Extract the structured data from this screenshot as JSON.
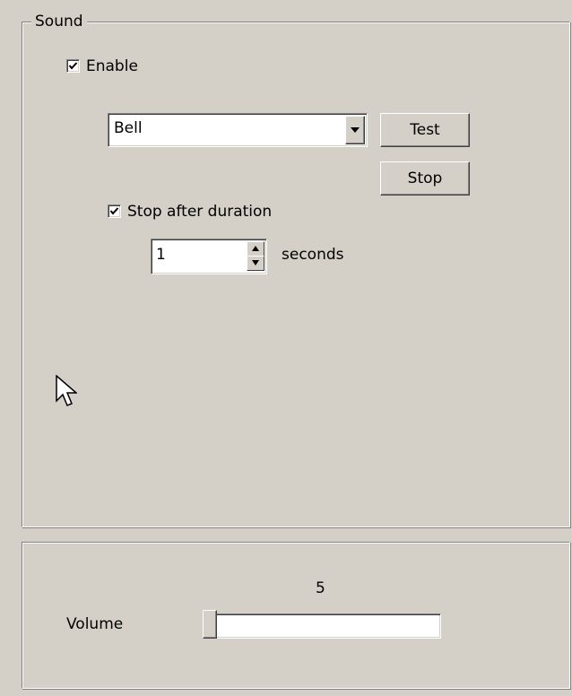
{
  "sound_group": {
    "legend": "Sound",
    "enable": {
      "label": "Enable",
      "checked": true
    },
    "sound_select": {
      "value": "Bell"
    },
    "test_label": "Test",
    "stop_label": "Stop",
    "stop_after": {
      "label": "Stop after duration",
      "checked": true
    },
    "duration": {
      "value": "1",
      "unit_label": "seconds"
    }
  },
  "volume_group": {
    "label": "Volume",
    "value": "5",
    "min": 0,
    "max": 100,
    "level": 0
  },
  "icons": [
    "check-icon",
    "dropdown-arrow-icon",
    "spin-up-icon",
    "spin-down-icon",
    "mouse-pointer-icon",
    "slider-thumb"
  ]
}
